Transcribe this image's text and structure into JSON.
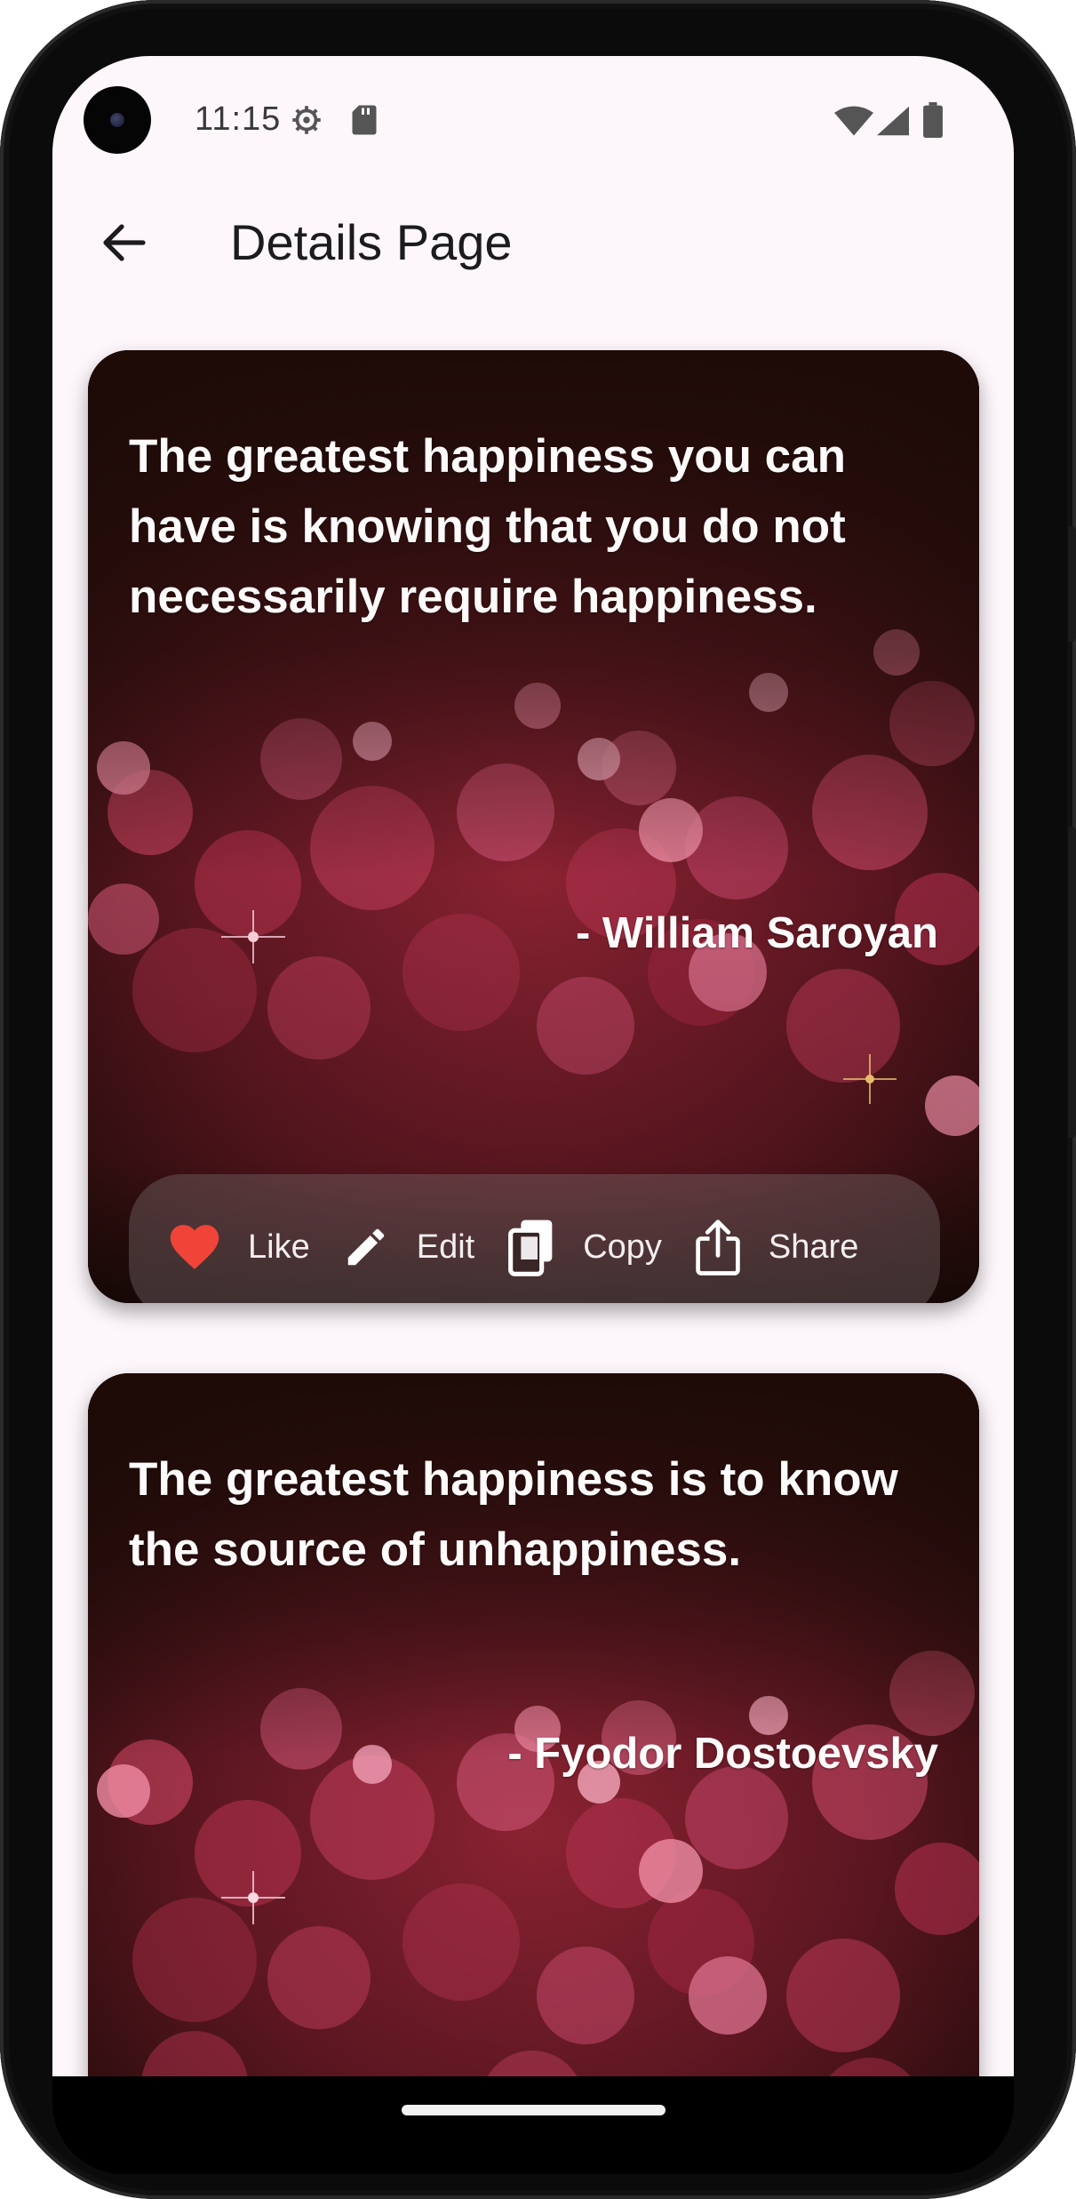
{
  "status_bar": {
    "time": "11:15",
    "icons": [
      "settings-icon",
      "sd-card-icon",
      "wifi-icon",
      "signal-icon",
      "battery-icon"
    ]
  },
  "app_bar": {
    "back_icon": "arrow-left-icon",
    "title": "Details Page"
  },
  "quotes": [
    {
      "text": "The greatest happiness you can have is knowing that you do not necessarily require happiness.",
      "author": "- William Saroyan",
      "actions": [
        {
          "label": "Like",
          "icon": "heart-icon",
          "color": "#f04438"
        },
        {
          "label": "Edit",
          "icon": "pencil-icon"
        },
        {
          "label": "Copy",
          "icon": "copy-icon"
        },
        {
          "label": "Share",
          "icon": "share-icon"
        }
      ]
    },
    {
      "text": "The greatest happiness is to know the source of unhappiness.",
      "author": "- Fyodor Dostoevsky"
    }
  ],
  "colors": {
    "screen_background": "#fdf7fb",
    "title_text": "#1c1b1f",
    "card_base": "#2a0e0d",
    "bokeh_accent": "#d9455f",
    "like_heart": "#f04438"
  }
}
